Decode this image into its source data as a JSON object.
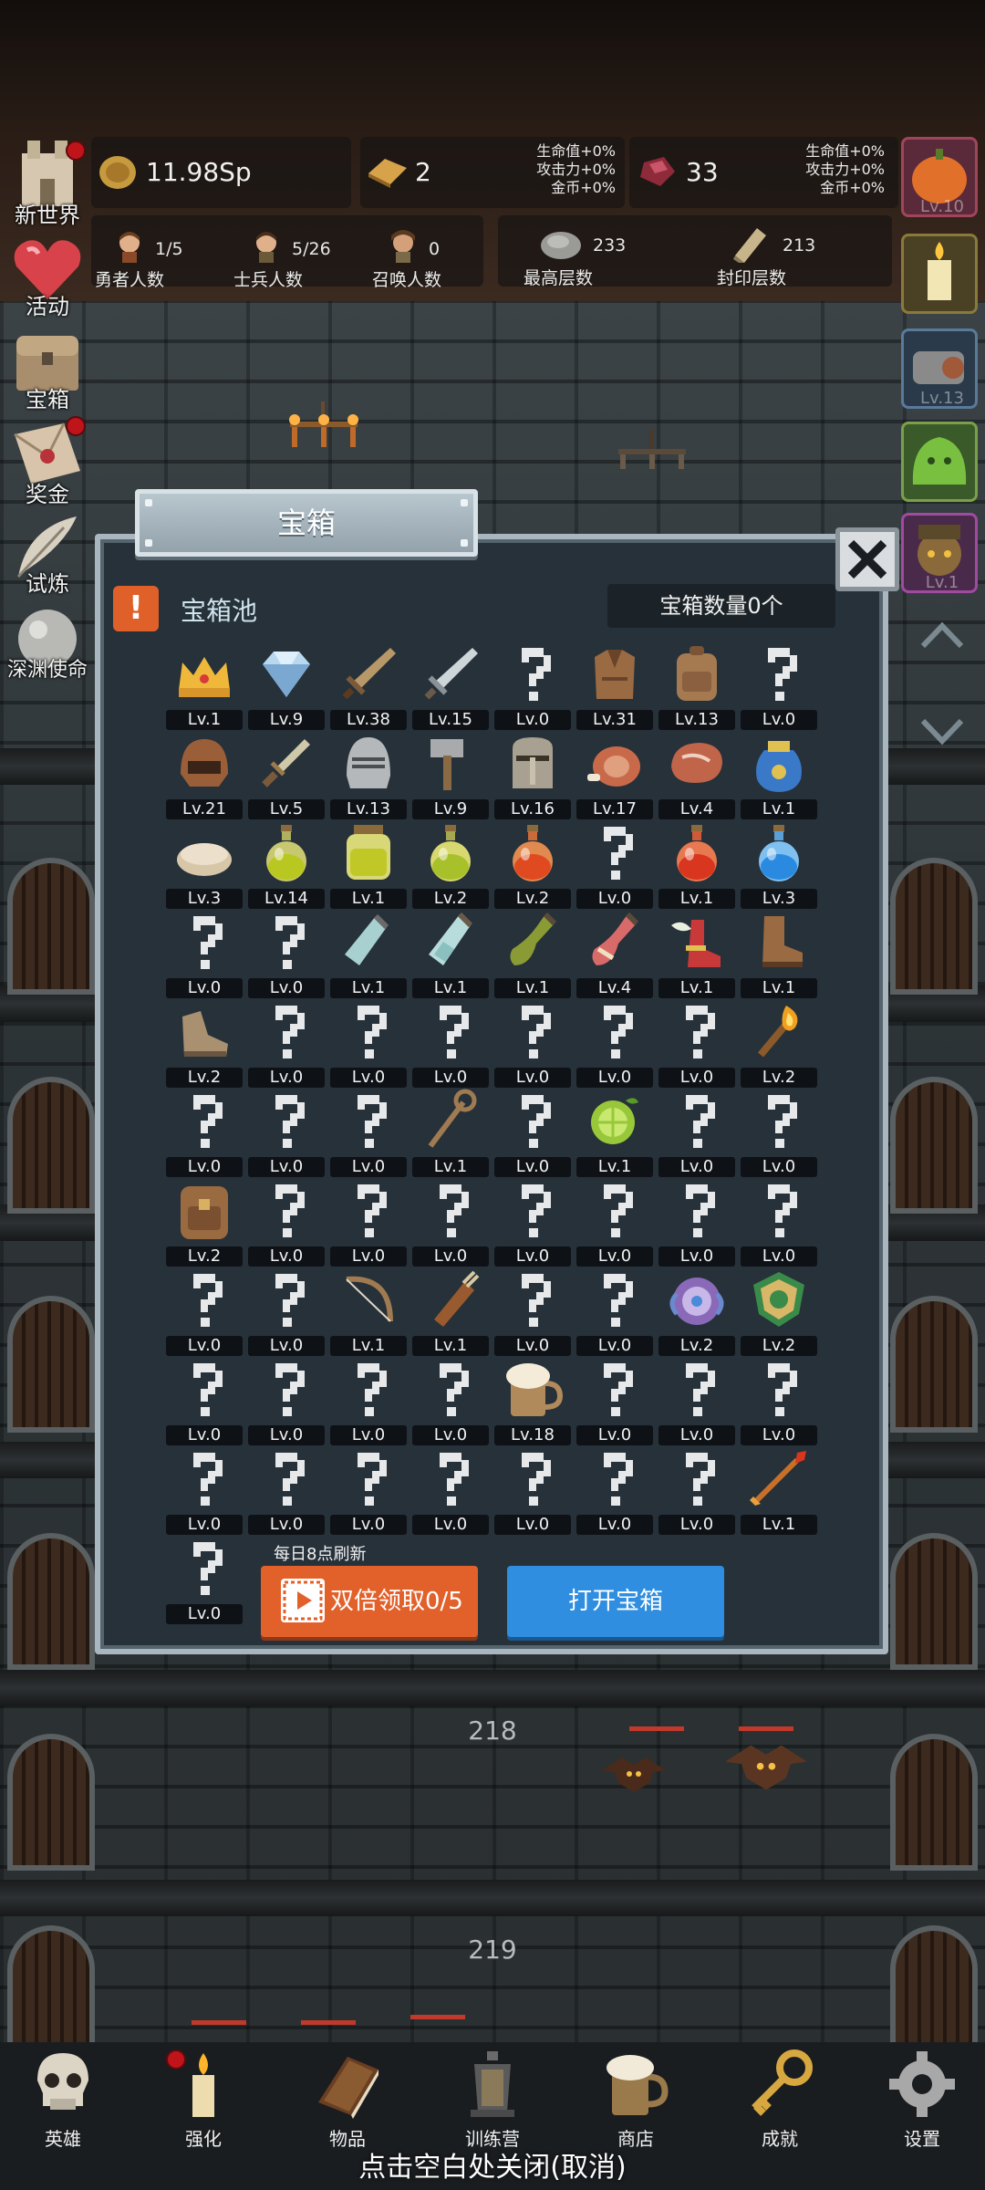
{
  "top_bar": {
    "coins": "11.98Sp",
    "gold_bars": "2",
    "gold_bonus": [
      "生命值+0%",
      "攻击力+0%",
      "金币+0%"
    ],
    "gems": "33",
    "gem_bonus": [
      "生命值+0%",
      "攻击力+0%",
      "金币+0%"
    ]
  },
  "stats": {
    "heroes": {
      "value": "1/5",
      "label": "勇者人数"
    },
    "soldiers": {
      "value": "5/26",
      "label": "士兵人数"
    },
    "summons": {
      "value": "0",
      "label": "召唤人数"
    },
    "max_floor": {
      "value": "233",
      "label": "最高层数"
    },
    "seal_floor": {
      "value": "213",
      "label": "封印层数"
    }
  },
  "left_menu": [
    {
      "label": "新世界",
      "dot": true
    },
    {
      "label": "活动",
      "dot": false
    },
    {
      "label": "宝箱",
      "dot": false
    },
    {
      "label": "奖金",
      "dot": true
    },
    {
      "label": "试炼",
      "dot": false
    },
    {
      "label": "深渊使命",
      "dot": false
    }
  ],
  "right_menu": [
    "Lv.10",
    "",
    "Lv.13",
    "",
    "Lv.1"
  ],
  "dialog": {
    "title": "宝箱",
    "pool_label": "宝箱池",
    "chest_count": "宝箱数量0个",
    "refresh_note": "每日8点刷新",
    "double_button": "双倍领取0/5",
    "open_button": "打开宝箱"
  },
  "items": [
    {
      "icon": "crown-icon",
      "level": "Lv.1"
    },
    {
      "icon": "diamond-icon",
      "level": "Lv.9"
    },
    {
      "icon": "sword-icon",
      "level": "Lv.38"
    },
    {
      "icon": "silver-sword-icon",
      "level": "Lv.15"
    },
    {
      "icon": "unknown-icon",
      "level": "Lv.0"
    },
    {
      "icon": "leather-armor-icon",
      "level": "Lv.31"
    },
    {
      "icon": "backpack-icon",
      "level": "Lv.13"
    },
    {
      "icon": "unknown-icon",
      "level": "Lv.0"
    },
    {
      "icon": "leather-helmet-icon",
      "level": "Lv.21"
    },
    {
      "icon": "dagger-icon",
      "level": "Lv.5"
    },
    {
      "icon": "knight-helmet-icon",
      "level": "Lv.13"
    },
    {
      "icon": "hammer-icon",
      "level": "Lv.9"
    },
    {
      "icon": "great-helm-icon",
      "level": "Lv.16"
    },
    {
      "icon": "ham-icon",
      "level": "Lv.17"
    },
    {
      "icon": "steak-icon",
      "level": "Lv.4"
    },
    {
      "icon": "blue-sack-icon",
      "level": "Lv.1"
    },
    {
      "icon": "bread-icon",
      "level": "Lv.3"
    },
    {
      "icon": "yellow-potion-icon",
      "level": "Lv.14"
    },
    {
      "icon": "yellow-jar-icon",
      "level": "Lv.1"
    },
    {
      "icon": "green-potion-icon",
      "level": "Lv.2"
    },
    {
      "icon": "orange-potion-icon",
      "level": "Lv.2"
    },
    {
      "icon": "unknown-icon",
      "level": "Lv.0"
    },
    {
      "icon": "red-potion-icon",
      "level": "Lv.1"
    },
    {
      "icon": "blue-potion-icon",
      "level": "Lv.3"
    },
    {
      "icon": "unknown-icon",
      "level": "Lv.0"
    },
    {
      "icon": "unknown-icon",
      "level": "Lv.0"
    },
    {
      "icon": "empty-vial-icon",
      "level": "Lv.1"
    },
    {
      "icon": "glass-vial-icon",
      "level": "Lv.1"
    },
    {
      "icon": "olive-bottle-icon",
      "level": "Lv.1"
    },
    {
      "icon": "red-bottle-icon",
      "level": "Lv.4"
    },
    {
      "icon": "winged-boot-icon",
      "level": "Lv.1"
    },
    {
      "icon": "boot-icon",
      "level": "Lv.1"
    },
    {
      "icon": "shoe-icon",
      "level": "Lv.2"
    },
    {
      "icon": "unknown-icon",
      "level": "Lv.0"
    },
    {
      "icon": "unknown-icon",
      "level": "Lv.0"
    },
    {
      "icon": "unknown-icon",
      "level": "Lv.0"
    },
    {
      "icon": "unknown-icon",
      "level": "Lv.0"
    },
    {
      "icon": "unknown-icon",
      "level": "Lv.0"
    },
    {
      "icon": "unknown-icon",
      "level": "Lv.0"
    },
    {
      "icon": "torch-icon",
      "level": "Lv.2"
    },
    {
      "icon": "unknown-icon",
      "level": "Lv.0"
    },
    {
      "icon": "unknown-icon",
      "level": "Lv.0"
    },
    {
      "icon": "unknown-icon",
      "level": "Lv.0"
    },
    {
      "icon": "staff-icon",
      "level": "Lv.1"
    },
    {
      "icon": "unknown-icon",
      "level": "Lv.0"
    },
    {
      "icon": "lime-icon",
      "level": "Lv.1"
    },
    {
      "icon": "unknown-icon",
      "level": "Lv.0"
    },
    {
      "icon": "unknown-icon",
      "level": "Lv.0"
    },
    {
      "icon": "rucksack-icon",
      "level": "Lv.2"
    },
    {
      "icon": "unknown-icon",
      "level": "Lv.0"
    },
    {
      "icon": "unknown-icon",
      "level": "Lv.0"
    },
    {
      "icon": "unknown-icon",
      "level": "Lv.0"
    },
    {
      "icon": "unknown-icon",
      "level": "Lv.0"
    },
    {
      "icon": "unknown-icon",
      "level": "Lv.0"
    },
    {
      "icon": "unknown-icon",
      "level": "Lv.0"
    },
    {
      "icon": "unknown-icon",
      "level": "Lv.0"
    },
    {
      "icon": "unknown-icon",
      "level": "Lv.0"
    },
    {
      "icon": "unknown-icon",
      "level": "Lv.0"
    },
    {
      "icon": "bow-icon",
      "level": "Lv.1"
    },
    {
      "icon": "quiver-icon",
      "level": "Lv.1"
    },
    {
      "icon": "unknown-icon",
      "level": "Lv.0"
    },
    {
      "icon": "unknown-icon",
      "level": "Lv.0"
    },
    {
      "icon": "amulet-icon",
      "level": "Lv.2"
    },
    {
      "icon": "emblem-icon",
      "level": "Lv.2"
    },
    {
      "icon": "unknown-icon",
      "level": "Lv.0"
    },
    {
      "icon": "unknown-icon",
      "level": "Lv.0"
    },
    {
      "icon": "unknown-icon",
      "level": "Lv.0"
    },
    {
      "icon": "unknown-icon",
      "level": "Lv.0"
    },
    {
      "icon": "beer-mug-icon",
      "level": "Lv.18"
    },
    {
      "icon": "unknown-icon",
      "level": "Lv.0"
    },
    {
      "icon": "unknown-icon",
      "level": "Lv.0"
    },
    {
      "icon": "unknown-icon",
      "level": "Lv.0"
    },
    {
      "icon": "unknown-icon",
      "level": "Lv.0"
    },
    {
      "icon": "unknown-icon",
      "level": "Lv.0"
    },
    {
      "icon": "unknown-icon",
      "level": "Lv.0"
    },
    {
      "icon": "unknown-icon",
      "level": "Lv.0"
    },
    {
      "icon": "unknown-icon",
      "level": "Lv.0"
    },
    {
      "icon": "unknown-icon",
      "level": "Lv.0"
    },
    {
      "icon": "unknown-icon",
      "level": "Lv.0"
    },
    {
      "icon": "flame-arrow-icon",
      "level": "Lv.1"
    },
    {
      "icon": "unknown-icon",
      "level": "Lv.0"
    }
  ],
  "scene": {
    "floor_upper": "218",
    "floor_lower": "219"
  },
  "bottom_nav": [
    "英雄",
    "强化",
    "物品",
    "训练营",
    "商店",
    "成就",
    "设置"
  ],
  "close_hint": "点击空白处关闭(取消)",
  "colors": {
    "accent_orange": "#e2612b",
    "accent_blue": "#2f8ee0",
    "panel": "#263139"
  }
}
